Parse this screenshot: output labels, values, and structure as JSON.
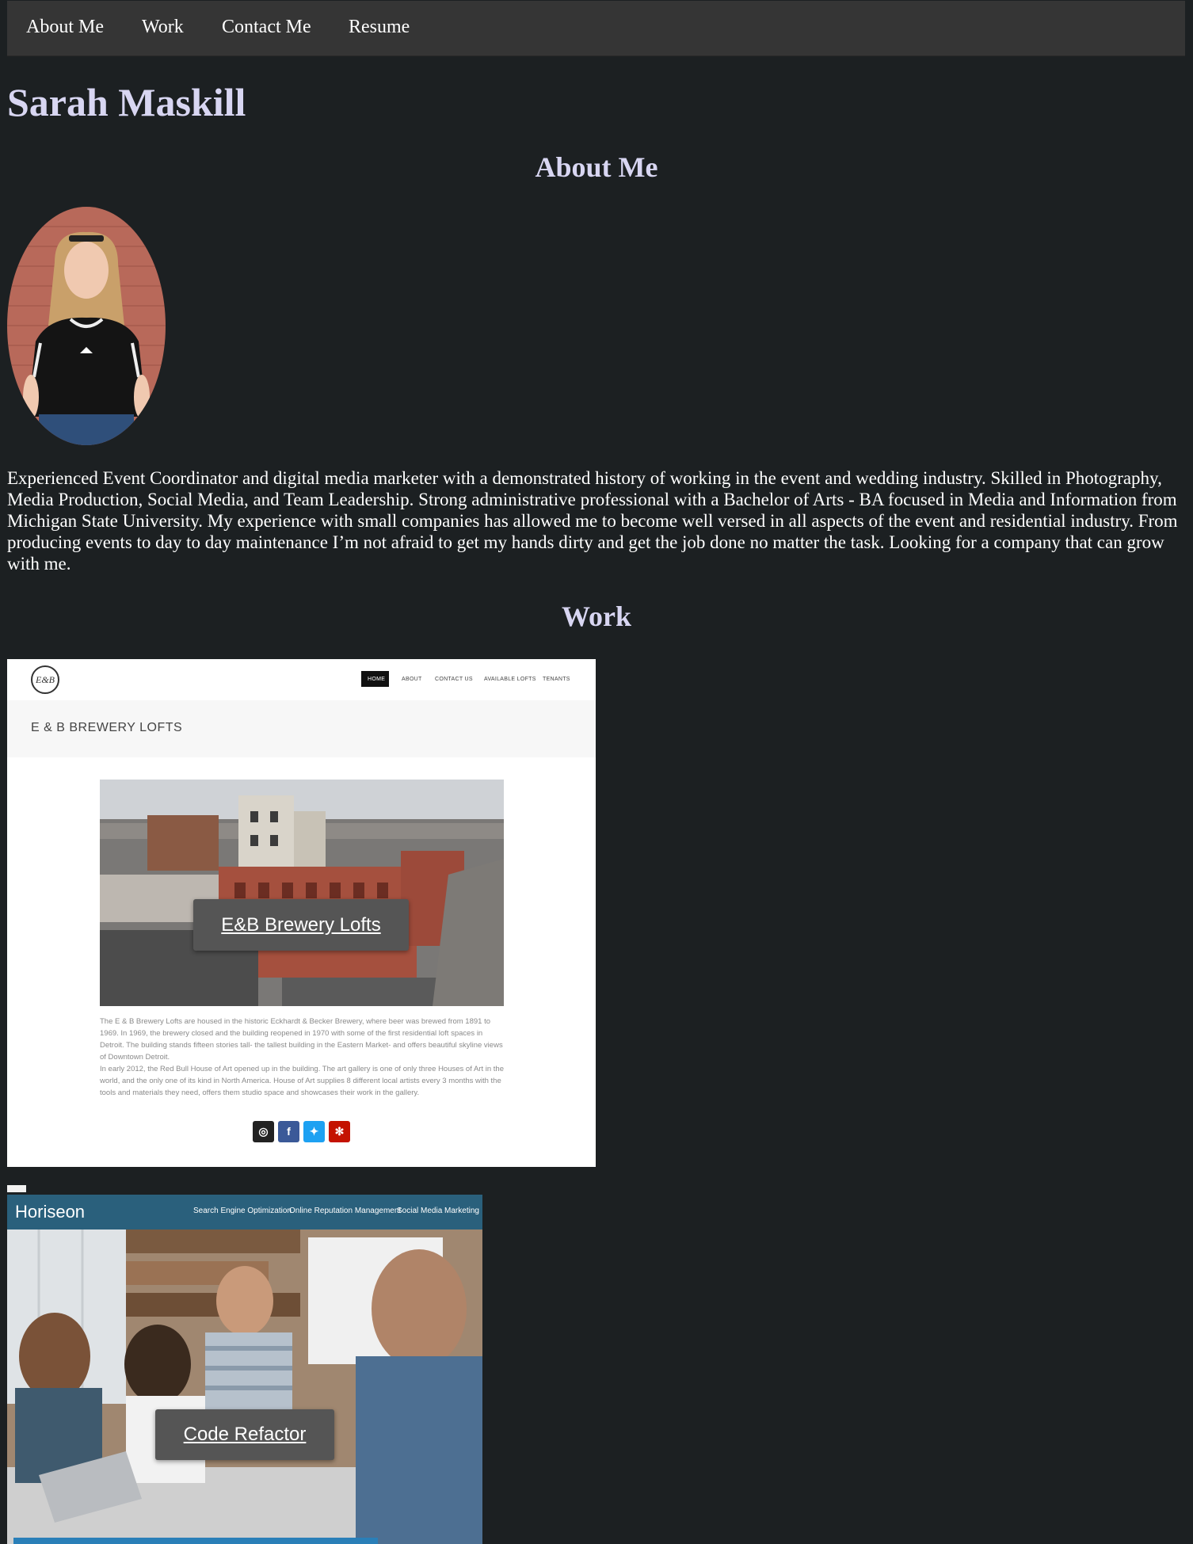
{
  "nav": {
    "items": [
      {
        "label": "About Me"
      },
      {
        "label": "Work"
      },
      {
        "label": "Contact Me"
      },
      {
        "label": "Resume"
      }
    ]
  },
  "header": {
    "name": "Sarah Maskill"
  },
  "about": {
    "title": "About Me",
    "bio": "Experienced Event Coordinator and digital media marketer with a demonstrated history of working in the event and wedding industry. Skilled in Photography, Media Production, Social Media, and Team Leadership. Strong administrative professional with a Bachelor of Arts - BA focused in Media and Information from Michigan State University. My experience with small companies has allowed me to become well versed in all aspects of the event and residential industry. From producing events to day to day maintenance I’m not afraid to get my hands dirty and get the job done no matter the task. Looking for a company that can grow with me."
  },
  "work": {
    "title": "Work",
    "projects": [
      {
        "label": "E&B Brewery Lofts",
        "preview": {
          "logo": "E&B",
          "nav": [
            "HOME",
            "ABOUT",
            "CONTACT US",
            "AVAILABLE LOFTS",
            "TENANTS"
          ],
          "heading": "E & B BREWERY LOFTS",
          "description_1": "The E & B Brewery Lofts are housed in the historic Eckhardt & Becker Brewery, where beer was brewed from 1891 to 1969. In 1969, the brewery closed and the building reopened in 1970 with some of the first residential loft spaces in Detroit. The building stands fifteen stories tall- the tallest building in the Eastern Market- and offers beautiful skyline views of Downtown Detroit.",
          "description_2": "In early 2012, the Red Bull House of Art opened up in the building. The art gallery is one of only three Houses of Art in the world, and the only one of its kind in North America. House of Art supplies 8 different local artists every 3 months with the tools and materials they need, offers them studio space and showcases their work in the gallery.",
          "social_icons": [
            "instagram-icon",
            "facebook-icon",
            "twitter-icon",
            "yelp-icon"
          ]
        }
      },
      {
        "label": "Code Refactor",
        "preview": {
          "brand": "Horiseon",
          "nav": [
            "Search Engine Optimization",
            "Online Reputation Management",
            "Social Media Marketing"
          ]
        }
      }
    ]
  },
  "colors": {
    "page_bg": "#1c2022",
    "nav_bg": "#353535",
    "heading": "#d8d6f2",
    "button_bg": "#555555",
    "horiseon_header": "#2a607c"
  }
}
